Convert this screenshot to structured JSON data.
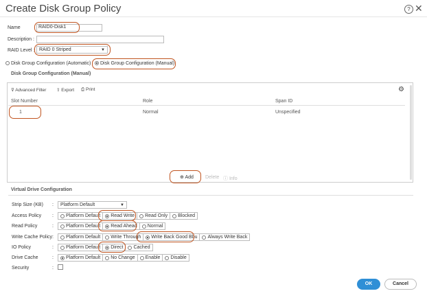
{
  "dialog": {
    "title": "Create Disk Group Policy",
    "help": "?",
    "close": "✕"
  },
  "form": {
    "name_label": "Name",
    "name_value": "RAID0-Disk1",
    "description_label": "Description :",
    "description_value": "",
    "raid_label": "RAID Level :",
    "raid_value": "RAID 0 Striped"
  },
  "config_mode": {
    "automatic": "Disk Group Configuration (Automatic)",
    "manual": "Disk Group Configuration (Manual)",
    "selected": "manual"
  },
  "manual_section": {
    "title": "Disk Group Configuration (Manual)",
    "toolbar": {
      "filter": "Advanced Filter",
      "export": "Export",
      "print": "Print"
    },
    "columns": [
      "Slot Number",
      "Role",
      "Span ID"
    ],
    "rows": [
      {
        "slot": "1",
        "role": "Normal",
        "span": "Unspecified"
      }
    ],
    "actions": {
      "add": "Add",
      "delete": "Delete",
      "info": "Info"
    }
  },
  "virtual_drive": {
    "title": "Virtual Drive Configuration",
    "strip_size": {
      "label": "Strip Size (KB)",
      "value": "Platform Default"
    },
    "access_policy": {
      "label": "Access Policy",
      "options": [
        "Platform Default",
        "Read Write",
        "Read Only",
        "Blocked"
      ],
      "selected": "Read Write"
    },
    "read_policy": {
      "label": "Read Policy",
      "options": [
        "Platform Default",
        "Read Ahead",
        "Normal"
      ],
      "selected": "Read Ahead"
    },
    "write_cache_policy": {
      "label": "Write Cache Policy",
      "options": [
        "Platform Default",
        "Write Through",
        "Write Back Good Bbu",
        "Always Write Back"
      ],
      "selected": "Write Back Good Bbu"
    },
    "io_policy": {
      "label": "IO Policy",
      "options": [
        "Platform Default",
        "Direct",
        "Cached"
      ],
      "selected": "Direct"
    },
    "drive_cache": {
      "label": "Drive Cache",
      "options": [
        "Platform Default",
        "No Change",
        "Enable",
        "Disable"
      ],
      "selected": "Platform Default"
    },
    "security": {
      "label": "Security",
      "checked": false
    },
    "colon": ":"
  },
  "buttons": {
    "ok": "OK",
    "cancel": "Cancel"
  },
  "colors": {
    "highlight": "#c0531e",
    "ok_button": "#2f8fd6"
  }
}
